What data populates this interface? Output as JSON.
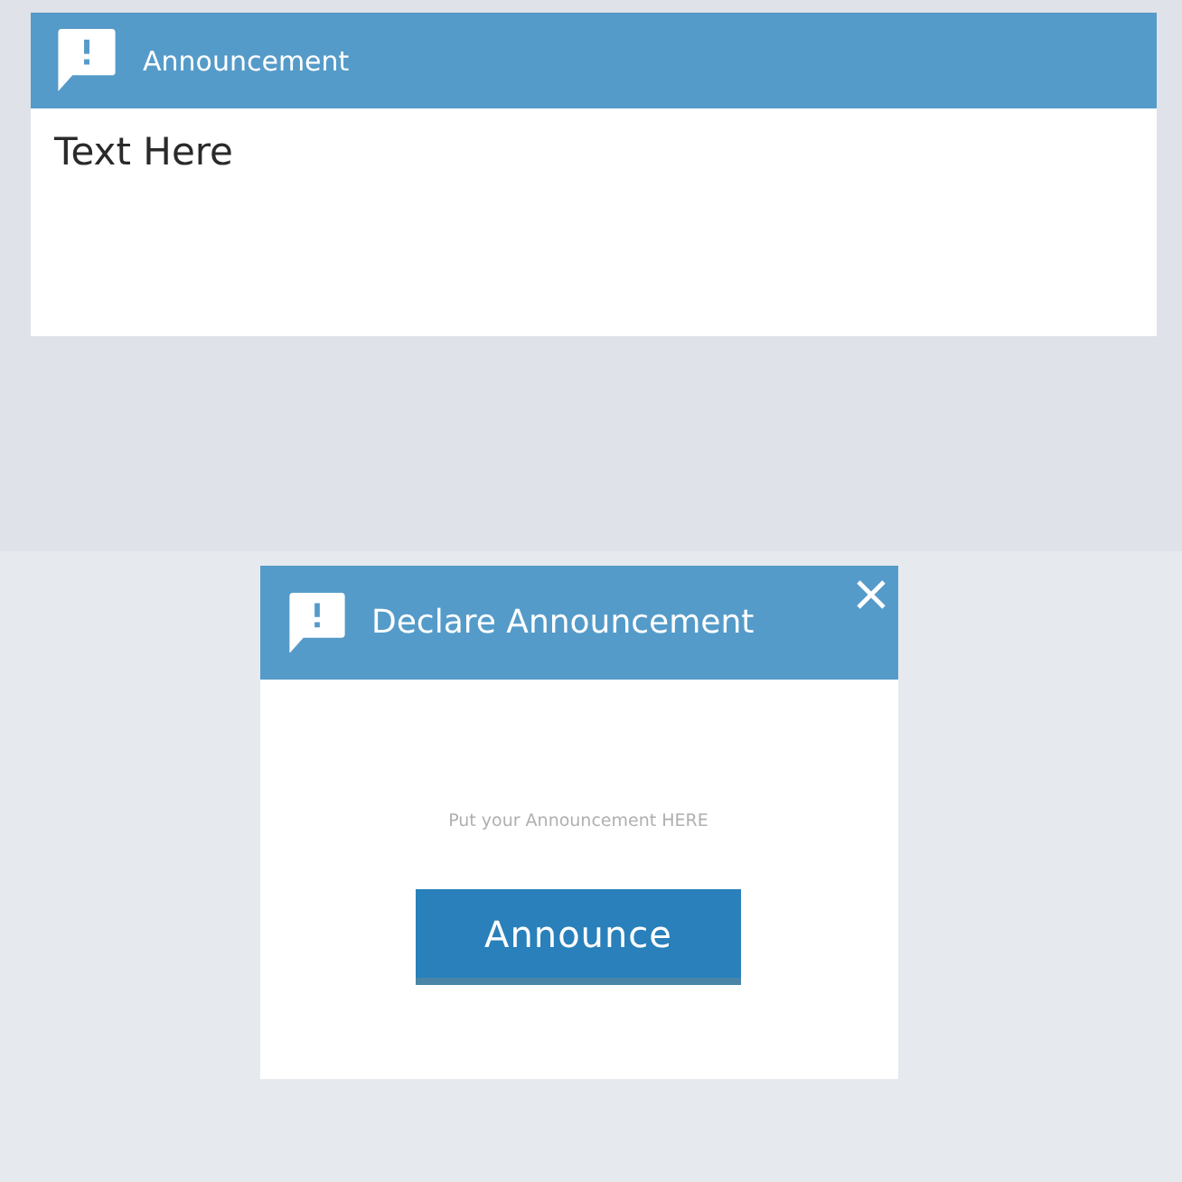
{
  "banner": {
    "title": "Announcement",
    "body": "Text Here"
  },
  "dialog": {
    "title": "Declare Announcement",
    "field": {
      "placeholder": "Put your Announcement HERE"
    },
    "button": "Announce"
  }
}
